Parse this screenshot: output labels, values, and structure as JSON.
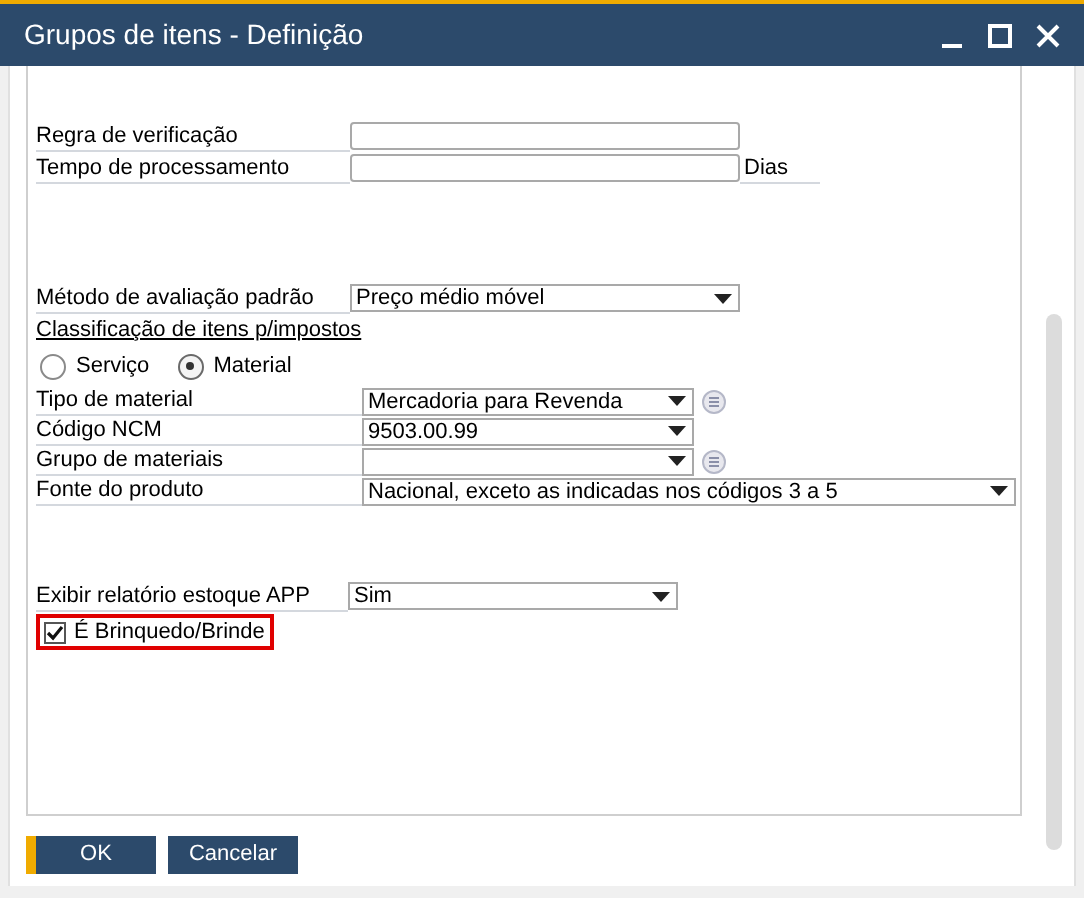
{
  "window": {
    "title": "Grupos de itens - Definição"
  },
  "fields_top": [
    {
      "label": "Regra de verificação",
      "kind": "text"
    },
    {
      "label": "Tempo de processamento",
      "kind": "text",
      "suffix": "Dias"
    }
  ],
  "valuation": {
    "label": "Método de avaliação padrão",
    "value": "Preço médio móvel"
  },
  "tax_section": {
    "title": "Classificação de itens p/impostos",
    "radios": [
      {
        "label": "Serviço",
        "selected": false
      },
      {
        "label": "Material",
        "selected": true
      }
    ],
    "fields": [
      {
        "label": "Tipo de material",
        "value": "Mercadoria para Revenda",
        "kind": "dropdown-link"
      },
      {
        "label": "Código NCM",
        "value": "9503.00.99",
        "kind": "dropdown"
      },
      {
        "label": "Grupo de materiais",
        "kind": "dropdown-link"
      },
      {
        "label": "Fonte do produto",
        "value": "Nacional, exceto as indicadas nos códigos 3 a 5",
        "kind": "dropdown-wide"
      }
    ]
  },
  "report": {
    "label": "Exibir relatório estoque APP",
    "value": "Sim"
  },
  "toy_checkbox": {
    "label": "É Brinquedo/Brinde",
    "checked": true,
    "highlighted": true
  },
  "buttons": [
    {
      "label": "OK",
      "kind": "primary"
    },
    {
      "label": "Cancelar",
      "kind": "normal"
    }
  ]
}
